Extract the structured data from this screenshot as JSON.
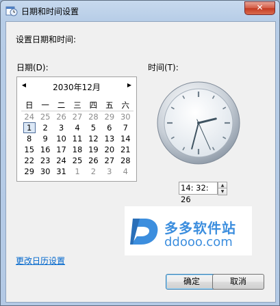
{
  "window": {
    "title": "日期和时间设置",
    "close_symbol": "✕"
  },
  "heading": "设置日期和时间:",
  "date_label": "日期(D):",
  "time_label": "时间(T):",
  "calendar": {
    "month_title": "2030年12月",
    "prev_symbol": "◀",
    "next_symbol": "▶",
    "weekdays": [
      "日",
      "一",
      "二",
      "三",
      "四",
      "五",
      "六"
    ],
    "weeks": [
      [
        "24",
        "25",
        "26",
        "27",
        "28",
        "29",
        "30"
      ],
      [
        "1",
        "2",
        "3",
        "4",
        "5",
        "6",
        "7"
      ],
      [
        "8",
        "9",
        "10",
        "11",
        "12",
        "13",
        "14"
      ],
      [
        "15",
        "16",
        "17",
        "18",
        "19",
        "20",
        "21"
      ],
      [
        "22",
        "23",
        "24",
        "25",
        "26",
        "27",
        "28"
      ],
      [
        "29",
        "30",
        "31",
        "1",
        "2",
        "3",
        "4"
      ]
    ],
    "selected_day": "1"
  },
  "clock": {
    "hour": 14,
    "minute": 32,
    "second": 26
  },
  "time_value": "14: 32: 26",
  "spinner": {
    "up_symbol": "▲",
    "down_symbol": "▼"
  },
  "watermark": {
    "cn": "多多软件站",
    "en": "ddooo.com"
  },
  "change_calendar_link": "更改日历设置",
  "buttons": {
    "ok": "确定",
    "cancel": "取消"
  }
}
